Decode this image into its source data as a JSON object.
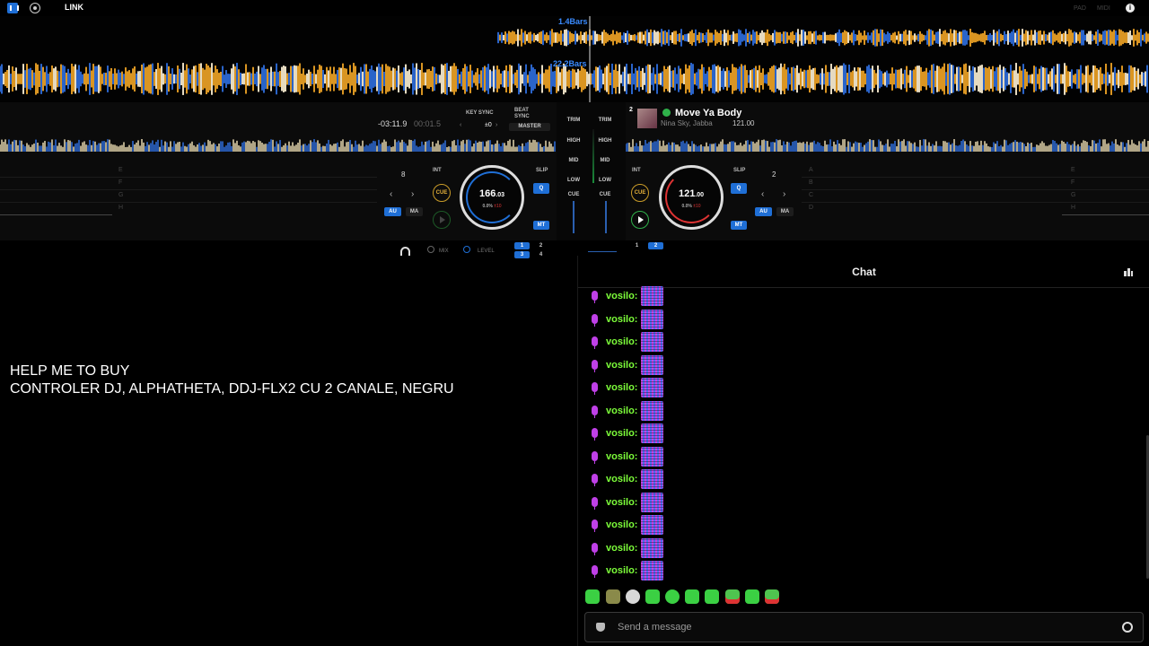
{
  "topbar": {
    "link_label": "LINK",
    "right_labels": [
      "PAD",
      "MIDI"
    ],
    "info_glyph": "i"
  },
  "waveform": {
    "deck2_bars": "1.4Bars",
    "deck1_bars": "22.2Bars"
  },
  "deck1": {
    "time_remaining": "-03:11.9",
    "time_elapsed": "00:01.5",
    "key_sync_label": "KEY SYNC",
    "beat_sync_label": "BEAT SYNC",
    "key_value": "±0",
    "master_label": "MASTER",
    "loop_value": "8",
    "int_label": "INT",
    "slip_label": "SLIP",
    "cue_label": "CUE",
    "q_label": "Q",
    "au_label": "AU",
    "ma_label": "MA",
    "mt_label": "MT",
    "bpm_main": "166",
    "bpm_decimal": ".03",
    "pitch": "0.0%",
    "pitch_range": "±10",
    "pad_letters": [
      "E",
      "F",
      "G",
      "H"
    ]
  },
  "deck2": {
    "number": "2",
    "title": "Move Ya Body",
    "artist": "Nina Sky, Jabba",
    "bpm_display": "121.00",
    "loop_value": "2",
    "int_label": "INT",
    "slip_label": "SLIP",
    "cue_label": "CUE",
    "q_label": "Q",
    "au_label": "AU",
    "ma_label": "MA",
    "mt_label": "MT",
    "bpm_main": "121",
    "bpm_decimal": ".00",
    "pitch": "0.0%",
    "pitch_range": "±10",
    "pad_letters_left": [
      "A",
      "B",
      "C",
      "D"
    ],
    "pad_letters_right": [
      "E",
      "F",
      "G",
      "H"
    ]
  },
  "mixer": {
    "labels": [
      "TRIM",
      "HIGH",
      "MID",
      "LOW",
      "CUE"
    ]
  },
  "bottom": {
    "mix_label": "MIX",
    "level_label": "LEVEL",
    "left_channels": [
      "1",
      "2",
      "3",
      "4"
    ],
    "right_channels": [
      "1",
      "2"
    ]
  },
  "stream_text": {
    "line1": "HELP ME TO BUY",
    "line2": "CONTROLER DJ, ALPHATHETA, DDJ-FLX2 CU 2 CANALE, NEGRU"
  },
  "chat": {
    "title": "Chat",
    "messages": [
      {
        "user": "vosilo:"
      },
      {
        "user": "vosilo:"
      },
      {
        "user": "vosilo:"
      },
      {
        "user": "vosilo:"
      },
      {
        "user": "vosilo:"
      },
      {
        "user": "vosilo:"
      },
      {
        "user": "vosilo:"
      },
      {
        "user": "vosilo:"
      },
      {
        "user": "vosilo:"
      },
      {
        "user": "vosilo:"
      },
      {
        "user": "vosilo:"
      },
      {
        "user": "vosilo:"
      },
      {
        "user": "vosilo:"
      }
    ],
    "placeholder": "Send a message",
    "colors": {
      "username": "#7dff3a",
      "badge": "#c040e8"
    }
  }
}
